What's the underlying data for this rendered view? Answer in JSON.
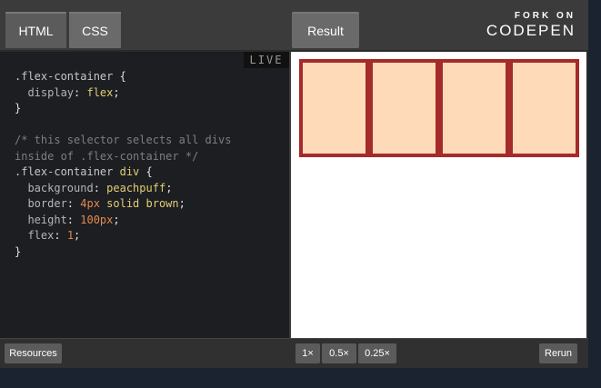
{
  "tabs": {
    "html": "HTML",
    "css": "CSS",
    "result": "Result"
  },
  "brand": {
    "top": "FORK ON",
    "name": "CODEPEN"
  },
  "live_badge": "LIVE",
  "code": {
    "l1_sel": ".flex-container",
    "l1_brace": " {",
    "l2_prop": "  display",
    "l2_val": "flex",
    "l3": "}",
    "l5": "/* this selector selects all divs",
    "l6": "inside of .flex-container */",
    "l7_sel": ".flex-container",
    "l7_tag": " div",
    "l7_brace": " {",
    "l8_prop": "  background",
    "l8_val": "peachpuff",
    "l9_prop": "  border",
    "l9_num": "4px",
    "l9_val": " solid brown",
    "l10_prop": "  height",
    "l10_num": "100px",
    "l11_prop": "  flex",
    "l11_num": "1",
    "l12": "}"
  },
  "result": {
    "item_count": 4,
    "item_background": "#ffdab9",
    "item_border_color": "#a52a2a"
  },
  "footer": {
    "resources": "Resources",
    "zoom_1": "1×",
    "zoom_05": "0.5×",
    "zoom_025": "0.25×",
    "rerun": "Rerun"
  },
  "colors": {
    "header_bg": "#3b3b3b",
    "code_bg": "#1d1e22",
    "tab_bg": "#5b5b5b"
  }
}
